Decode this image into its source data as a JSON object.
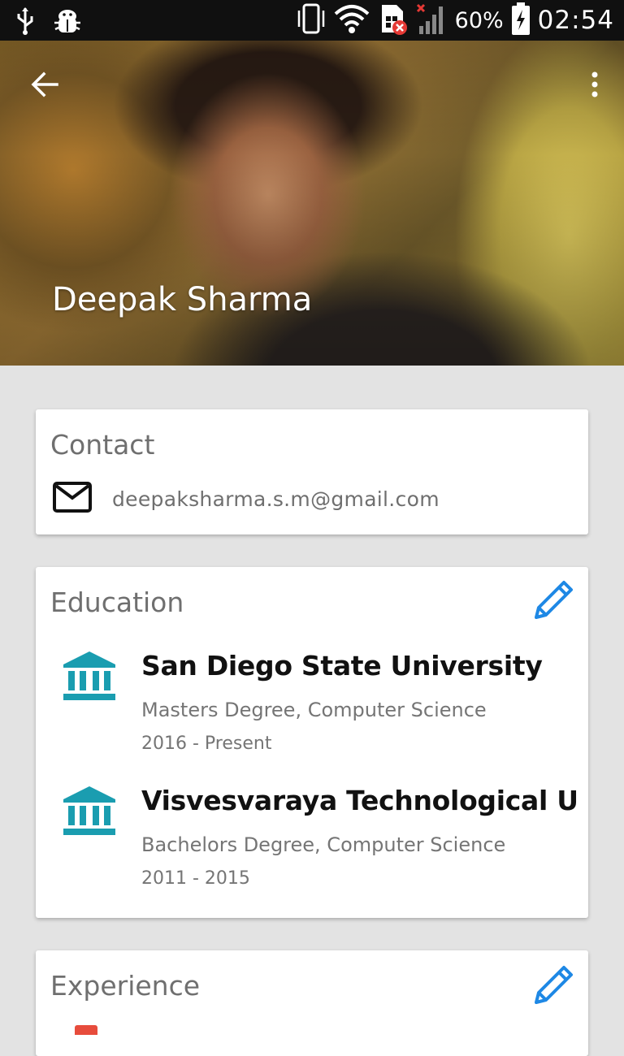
{
  "status_bar": {
    "battery": "60%",
    "time": "02:54",
    "icons": [
      "usb-icon",
      "android-debug-icon",
      "vibrate-icon",
      "wifi-icon",
      "sim-error-icon",
      "signal-icon",
      "battery-charging-icon"
    ]
  },
  "header": {
    "name": "Deepak Sharma",
    "back_icon": "arrow-back-icon",
    "menu_icon": "more-vertical-icon"
  },
  "contact": {
    "title": "Contact",
    "email": "deepaksharma.s.m@gmail.com",
    "icon": "mail-icon"
  },
  "education": {
    "title": "Education",
    "edit_icon": "pencil-icon",
    "items": [
      {
        "school": "San Diego State University",
        "degree": "Masters Degree, Computer Science",
        "years": "2016 - Present"
      },
      {
        "school": "Visvesvaraya Technological U",
        "degree": "Bachelors Degree, Computer Science",
        "years": "2011 - 2015"
      }
    ]
  },
  "experience": {
    "title": "Experience",
    "edit_icon": "pencil-icon"
  },
  "colors": {
    "accent": "#1e88e5",
    "institution_icon": "#1a9db0",
    "background": "#e3e3e3"
  }
}
